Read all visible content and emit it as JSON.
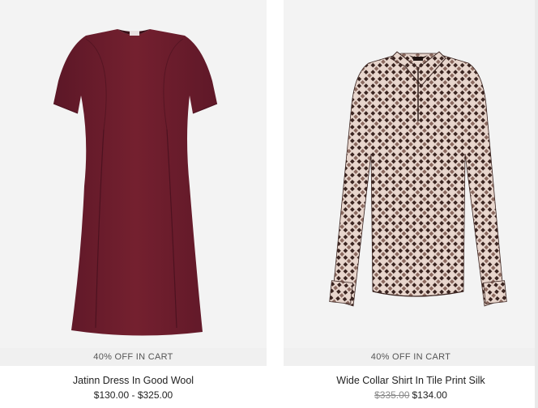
{
  "products": [
    {
      "name": "Jatinn Dress In Good Wool",
      "promo": "40% OFF IN CART",
      "price_range": "$130.00 - $325.00",
      "image_semantic": "burgundy-short-sleeve-dress",
      "color": "#6e1f2f"
    },
    {
      "name": "Wide Collar Shirt In Tile Print Silk",
      "promo": "40% OFF IN CART",
      "original_price": "$335.00",
      "sale_price": "$134.00",
      "image_semantic": "tile-print-silk-shirt",
      "color": "#3a2420"
    }
  ]
}
